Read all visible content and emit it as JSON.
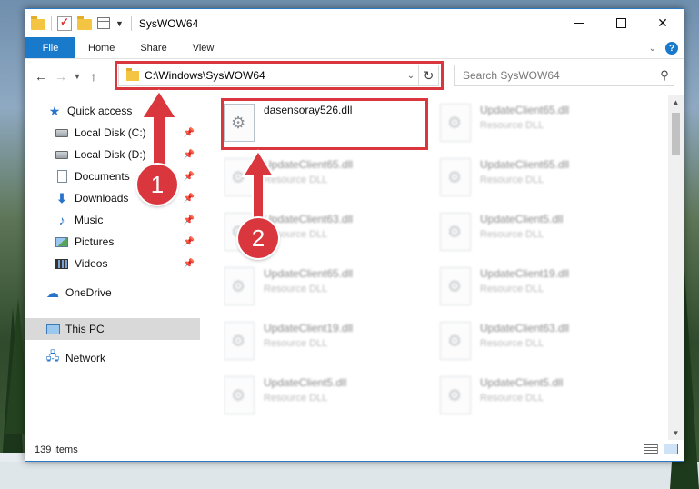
{
  "window": {
    "title": "SysWOW64"
  },
  "ribbon": {
    "tabs": [
      "File",
      "Home",
      "Share",
      "View"
    ]
  },
  "address": {
    "path": "C:\\Windows\\SysWOW64"
  },
  "search": {
    "placeholder": "Search SysWOW64"
  },
  "nav": {
    "items": [
      {
        "label": "Quick access",
        "icon": "star-icon"
      },
      {
        "label": "Local Disk (C:)",
        "icon": "disk-icon",
        "pinned": true
      },
      {
        "label": "Local Disk (D:)",
        "icon": "disk-icon",
        "pinned": true
      },
      {
        "label": "Documents",
        "icon": "document-icon",
        "pinned": true
      },
      {
        "label": "Downloads",
        "icon": "download-icon",
        "pinned": true
      },
      {
        "label": "Music",
        "icon": "music-icon",
        "pinned": true
      },
      {
        "label": "Pictures",
        "icon": "pictures-icon",
        "pinned": true
      },
      {
        "label": "Videos",
        "icon": "videos-icon",
        "pinned": true
      },
      {
        "label": "OneDrive",
        "icon": "cloud-icon"
      },
      {
        "label": "This PC",
        "icon": "computer-icon",
        "selected": true
      },
      {
        "label": "Network",
        "icon": "network-icon"
      }
    ]
  },
  "files": {
    "highlighted": {
      "name": "dasensoray526.dll",
      "type": ""
    },
    "left_column": [
      {
        "name": "UpdateClient65.dll",
        "type": "Resource DLL"
      },
      {
        "name": "UpdateClient63.dll",
        "type": "Resource DLL"
      },
      {
        "name": "UpdateClient65.dll",
        "type": "Resource DLL"
      },
      {
        "name": "UpdateClient19.dll",
        "type": "Resource DLL"
      },
      {
        "name": "UpdateClient5.dll",
        "type": "Resource DLL"
      }
    ],
    "right_column": [
      {
        "name": "UpdateClient65.dll",
        "type": "Resource DLL"
      },
      {
        "name": "UpdateClient65.dll",
        "type": "Resource DLL"
      },
      {
        "name": "UpdateClient5.dll",
        "type": "Resource DLL"
      },
      {
        "name": "UpdateClient19.dll",
        "type": "Resource DLL"
      },
      {
        "name": "UpdateClient63.dll",
        "type": "Resource DLL"
      },
      {
        "name": "UpdateClient5.dll",
        "type": "Resource DLL"
      }
    ]
  },
  "status": {
    "item_count": "139 items"
  },
  "annotations": {
    "step1": "1",
    "step2": "2",
    "color": "#d9363e"
  }
}
